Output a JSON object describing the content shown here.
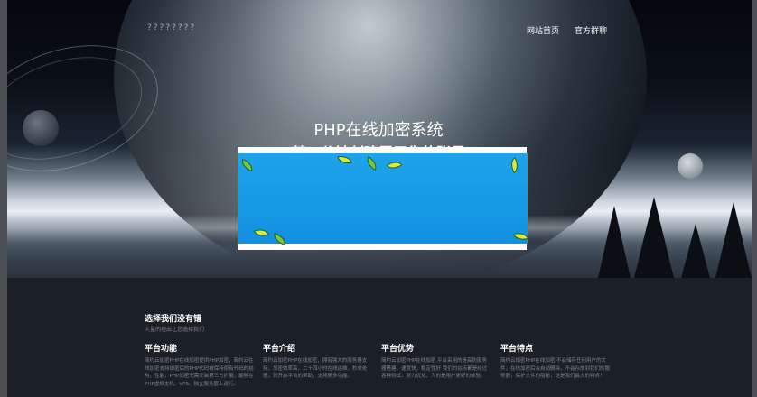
{
  "header": {
    "logo_text": "????????",
    "nav": [
      {
        "label": "网站首页"
      },
      {
        "label": "官方群聊"
      }
    ]
  },
  "hero": {
    "title": "PHP在线加密系统",
    "subtitle": "某一分钟创建属于你的账号"
  },
  "main": {
    "section_title": "选择我们没有错",
    "section_subtitle": "大量的理由让您选择我们",
    "columns": [
      {
        "title": "平台功能",
        "text": "简约云加密PHP在线加密提供PHP加密，简约云在线加密支持加密后的PHP代码被保持原有代码的结构，性能，PHP加密无需安装第三方扩展，能够在PHP虚拟主机、VPS、独立服务器上运行。"
      },
      {
        "title": "平台介绍",
        "text": "简约云加密PHP在线加密，拥有强大的服务器支持，加密效率高，二十四小时在线运维，秒单处理，就开启平台的帮助，支持更多功能。"
      },
      {
        "title": "平台优势",
        "text": "简约云加密PHP在线加密,平台采用的是高防服务器搭建，速度快，稳定性好 我们的站点都是经过各种测试，努力优化，为的是用户更好的体验。"
      },
      {
        "title": "平台特点",
        "text": "简约云加密PHP在线加密,不会储存任何用户的文件，在线加密后会自动删除，不会存放到我们的服务器，保护文件的隐秘，这是我们最大的特点！"
      }
    ]
  }
}
